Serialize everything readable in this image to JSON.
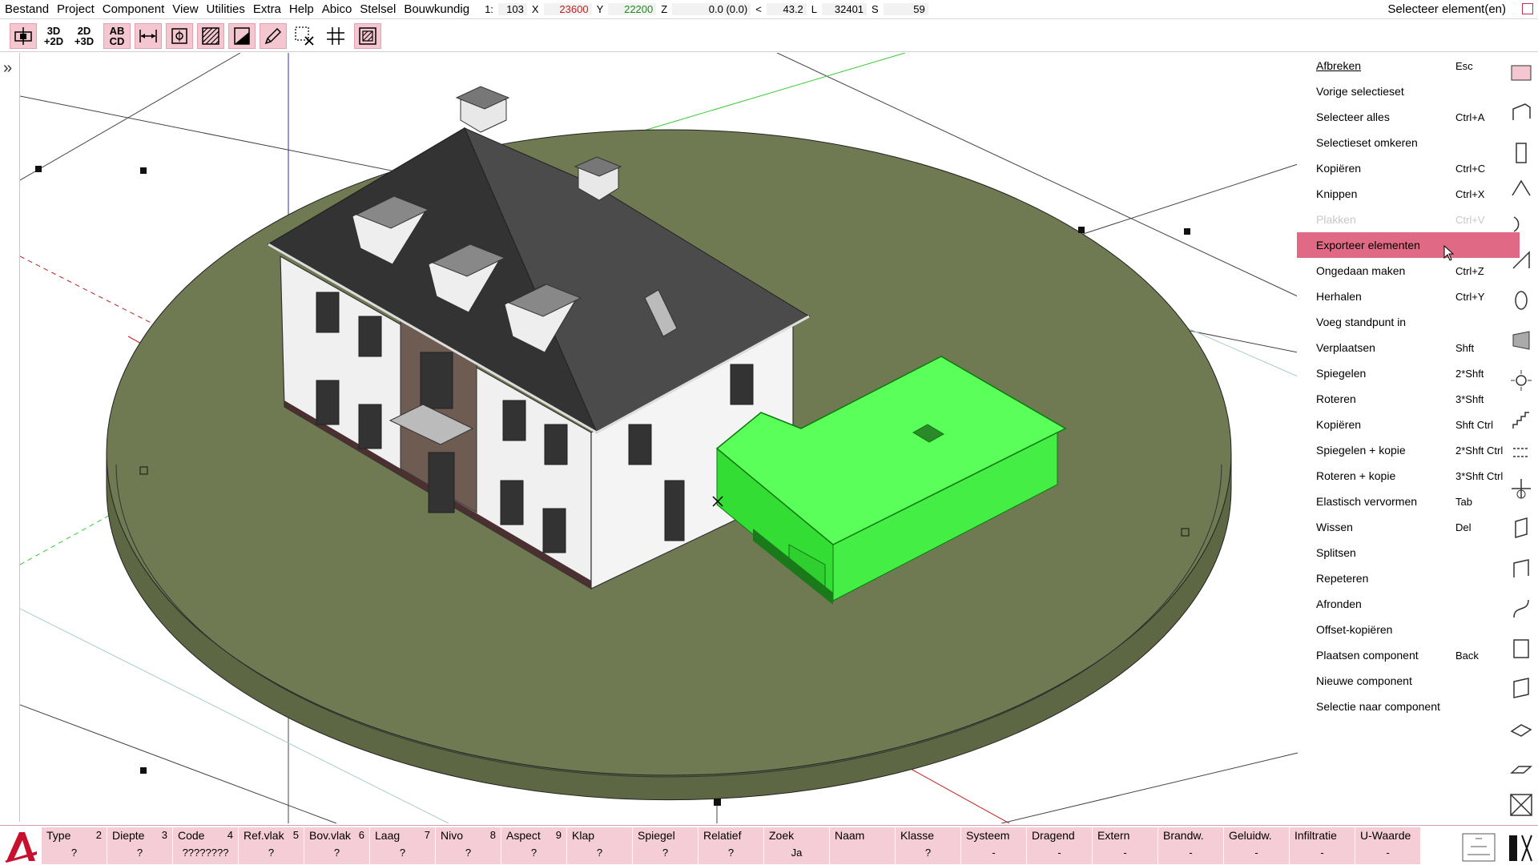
{
  "menubar": {
    "items": [
      "Bestand",
      "Project",
      "Component",
      "View",
      "Utilities",
      "Extra",
      "Help",
      "Abico",
      "Stelsel",
      "Bouwkundig"
    ],
    "coords": {
      "scale_label": "1:",
      "scale_value": "103",
      "x_label": "X",
      "x_value": "23600",
      "y_label": "Y",
      "y_value": "22200",
      "z_label": "Z",
      "z_value": "0.0 (0.0)",
      "angle_label": "<",
      "angle_value": "43.2",
      "l_label": "L",
      "l_value": "32401",
      "s_label": "S",
      "s_value": "59"
    },
    "status": "Selecteer element(en)"
  },
  "toolbar": {
    "btn_3d2d": "3D\n+2D",
    "btn_2d3d": "2D\n+3D",
    "btn_abcd": "AB\nCD"
  },
  "context_menu": {
    "items": [
      {
        "label": "Afbreken",
        "shortcut": "Esc",
        "state": "normal"
      },
      {
        "label": "Vorige selectieset",
        "shortcut": "",
        "state": "normal"
      },
      {
        "label": "Selecteer alles",
        "shortcut": "Ctrl+A",
        "state": "normal"
      },
      {
        "label": "Selectieset omkeren",
        "shortcut": "",
        "state": "normal"
      },
      {
        "label": "Kopiëren",
        "shortcut": "Ctrl+C",
        "state": "normal"
      },
      {
        "label": "Knippen",
        "shortcut": "Ctrl+X",
        "state": "normal"
      },
      {
        "label": "Plakken",
        "shortcut": "Ctrl+V",
        "state": "disabled"
      },
      {
        "label": "Exporteer elementen",
        "shortcut": "",
        "state": "highlighted"
      },
      {
        "label": "Ongedaan maken",
        "shortcut": "Ctrl+Z",
        "state": "normal"
      },
      {
        "label": "Herhalen",
        "shortcut": "Ctrl+Y",
        "state": "normal"
      },
      {
        "label": "Voeg standpunt in",
        "shortcut": "",
        "state": "normal"
      },
      {
        "label": "Verplaatsen",
        "shortcut": "Shft",
        "state": "normal"
      },
      {
        "label": "Spiegelen",
        "shortcut": "2*Shft",
        "state": "normal"
      },
      {
        "label": "Roteren",
        "shortcut": "3*Shft",
        "state": "normal"
      },
      {
        "label": "Kopiëren",
        "shortcut": "Shft Ctrl",
        "state": "normal"
      },
      {
        "label": "Spiegelen + kopie",
        "shortcut": "2*Shft Ctrl",
        "state": "normal"
      },
      {
        "label": "Roteren + kopie",
        "shortcut": "3*Shft Ctrl",
        "state": "normal"
      },
      {
        "label": "Elastisch vervormen",
        "shortcut": "Tab",
        "state": "normal"
      },
      {
        "label": "Wissen",
        "shortcut": "Del",
        "state": "normal"
      },
      {
        "label": "Splitsen",
        "shortcut": "",
        "state": "normal"
      },
      {
        "label": "Repeteren",
        "shortcut": "",
        "state": "normal"
      },
      {
        "label": "Afronden",
        "shortcut": "",
        "state": "normal"
      },
      {
        "label": "Offset-kopiëren",
        "shortcut": "",
        "state": "normal"
      },
      {
        "label": "Plaatsen component",
        "shortcut": "Back",
        "state": "normal"
      },
      {
        "label": "Nieuwe component",
        "shortcut": "",
        "state": "normal"
      },
      {
        "label": "Selectie naar component",
        "shortcut": "",
        "state": "normal"
      }
    ]
  },
  "properties": [
    {
      "label": "Type",
      "num": "2",
      "value": "?"
    },
    {
      "label": "Diepte",
      "num": "3",
      "value": "?"
    },
    {
      "label": "Code",
      "num": "4",
      "value": "????????"
    },
    {
      "label": "Ref.vlak",
      "num": "5",
      "value": "?"
    },
    {
      "label": "Bov.vlak",
      "num": "6",
      "value": "?"
    },
    {
      "label": "Laag",
      "num": "7",
      "value": "?"
    },
    {
      "label": "Nivo",
      "num": "8",
      "value": "?"
    },
    {
      "label": "Aspect",
      "num": "9",
      "value": "?"
    },
    {
      "label": "Klap",
      "num": "",
      "value": "?"
    },
    {
      "label": "Spiegel",
      "num": "",
      "value": "?"
    },
    {
      "label": "Relatief",
      "num": "",
      "value": "?"
    },
    {
      "label": "Zoek",
      "num": "",
      "value": "Ja"
    },
    {
      "label": "Naam",
      "num": "",
      "value": ""
    },
    {
      "label": "Klasse",
      "num": "",
      "value": "?"
    },
    {
      "label": "Systeem",
      "num": "",
      "value": "-"
    },
    {
      "label": "Dragend",
      "num": "",
      "value": "-"
    },
    {
      "label": "Extern",
      "num": "",
      "value": "-"
    },
    {
      "label": "Brandw.",
      "num": "",
      "value": "-"
    },
    {
      "label": "Geluidw.",
      "num": "",
      "value": "-"
    },
    {
      "label": "Infiltratie",
      "num": "",
      "value": "-"
    },
    {
      "label": "U-Waarde",
      "num": "",
      "value": "-"
    }
  ],
  "colors": {
    "ground": "#6f7a52",
    "ground_side": "#5e6743",
    "selected_green": "#44ee44",
    "menu_highlight": "#e06a85",
    "prop_bg": "#f4cdd6"
  }
}
